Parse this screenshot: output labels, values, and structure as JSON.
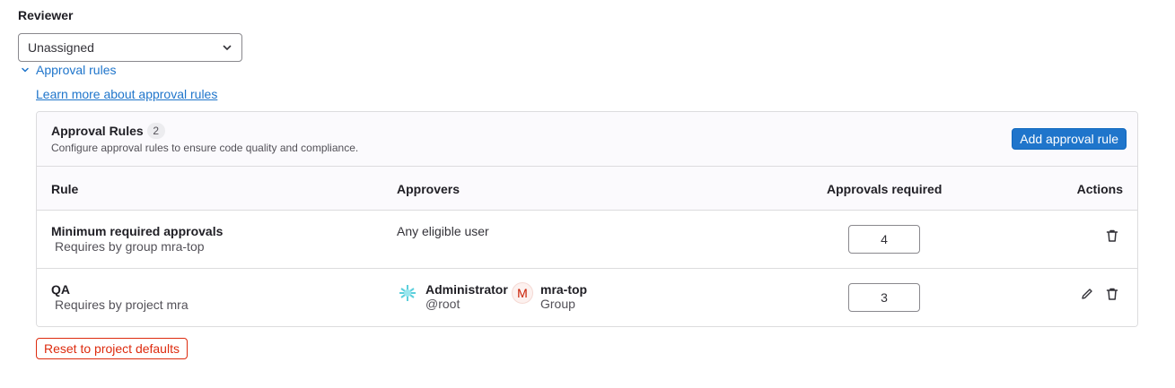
{
  "reviewer": {
    "label": "Reviewer",
    "selected": "Unassigned"
  },
  "approval_section": {
    "toggle_label": "Approval rules",
    "learn_more": "Learn more about approval rules"
  },
  "card": {
    "title": "Approval Rules",
    "count": "2",
    "description": "Configure approval rules to ensure code quality and compliance.",
    "add_button": "Add approval rule"
  },
  "table": {
    "headers": {
      "rule": "Rule",
      "approvers": "Approvers",
      "approvals_required": "Approvals required",
      "actions": "Actions"
    },
    "rows": [
      {
        "name": "Minimum required approvals",
        "sub": "Requires by group mra-top",
        "approvers_text": "Any eligible user",
        "approvals": "4"
      },
      {
        "name": "QA",
        "sub": "Requires by project mra",
        "approvers": [
          {
            "name": "Administrator",
            "sub": "@root",
            "avatar": "admin-avatar-icon"
          },
          {
            "name": "mra-top",
            "sub": "Group",
            "avatar_letter": "M"
          }
        ],
        "approvals": "3"
      }
    ]
  },
  "reset_button": "Reset to project defaults",
  "colors": {
    "link": "#1f75cb",
    "primary_button": "#1f75cb",
    "danger": "#dd2b0e"
  }
}
